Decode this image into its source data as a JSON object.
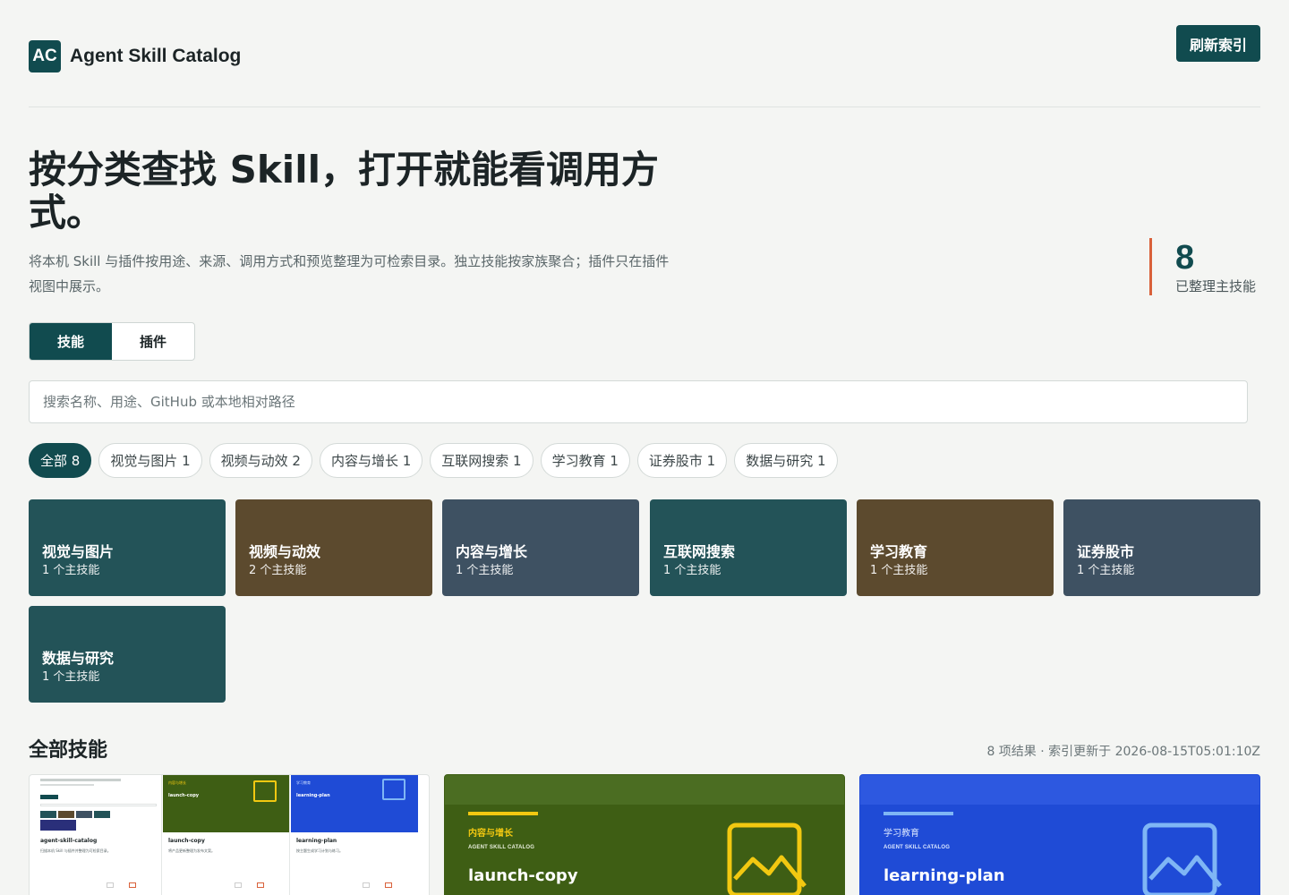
{
  "header": {
    "logo": "AC",
    "title": "Agent Skill Catalog",
    "refresh_label": "刷新索引"
  },
  "hero": {
    "title": "按分类查找 Skill，打开就能看调用方式。",
    "subtitle": "将本机 Skill 与插件按用途、来源、调用方式和预览整理为可检索目录。独立技能按家族聚合；插件只在插件视图中展示。",
    "stat_value": "8",
    "stat_label": "已整理主技能"
  },
  "tabs": [
    {
      "label": "技能",
      "active": true
    },
    {
      "label": "插件",
      "active": false
    }
  ],
  "search": {
    "placeholder": "搜索名称、用途、GitHub 或本地相对路径",
    "value": ""
  },
  "chips": [
    {
      "label": "全部 8",
      "active": true
    },
    {
      "label": "视觉与图片 1",
      "active": false
    },
    {
      "label": "视频与动效 2",
      "active": false
    },
    {
      "label": "内容与增长 1",
      "active": false
    },
    {
      "label": "互联网搜索 1",
      "active": false
    },
    {
      "label": "学习教育 1",
      "active": false
    },
    {
      "label": "证券股市 1",
      "active": false
    },
    {
      "label": "数据与研究 1",
      "active": false
    }
  ],
  "categories": [
    {
      "name": "视觉与图片",
      "count": "1 个主技能",
      "color": "#235358"
    },
    {
      "name": "视频与动效",
      "count": "2 个主技能",
      "color": "#5c4a2e"
    },
    {
      "name": "内容与增长",
      "count": "1 个主技能",
      "color": "#3e5162"
    },
    {
      "name": "互联网搜索",
      "count": "1 个主技能",
      "color": "#235358"
    },
    {
      "name": "学习教育",
      "count": "1 个主技能",
      "color": "#5c4a2e"
    },
    {
      "name": "证券股市",
      "count": "1 个主技能",
      "color": "#3e5162"
    },
    {
      "name": "数据与研究",
      "count": "1 个主技能",
      "color": "#235358"
    }
  ],
  "section": {
    "title": "全部技能",
    "meta": "8 项结果 · 索引更新于 2026-08-15T05:01:10Z"
  },
  "cards": [
    {
      "minis": [
        {
          "name": "agent-skill-catalog",
          "lbl": "",
          "desc": "扫描本机 Skill 与插件并整理为可检索目录。",
          "head": "#ffffff"
        },
        {
          "name": "launch-copy",
          "lbl": "内容与增长",
          "desc": "将产品更新整理为发布文案。",
          "head": "#3e5e14"
        },
        {
          "name": "learning-plan",
          "lbl": "学习教育",
          "desc": "按主题生成学习计划与练习。",
          "head": "#1f4bd6"
        }
      ]
    },
    {
      "category": "内容与增长",
      "brand": "AGENT SKILL CATALOG",
      "name": "launch-copy",
      "accent": "#f2c811",
      "band": "#4b6d22"
    },
    {
      "category": "学习教育",
      "brand": "AGENT SKILL CATALOG",
      "name": "learning-plan",
      "accent": "#7fb6f5",
      "band": "#2d58e0"
    }
  ]
}
